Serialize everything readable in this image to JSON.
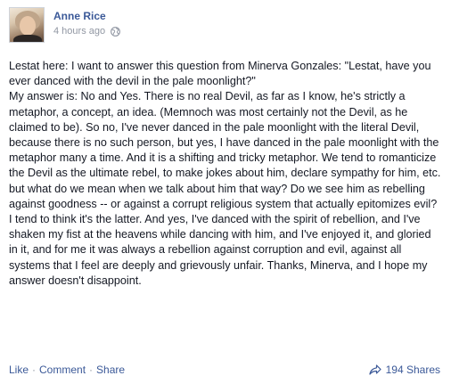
{
  "post": {
    "author": "Anne Rice",
    "timestamp": "4 hours ago",
    "privacy_icon": "globe-icon",
    "paragraphs": [
      "Lestat here: I want to answer this question from Minerva Gonzales: \"Lestat, have you ever danced with the devil in the pale moonlight?\"",
      "My answer is: No and Yes. There is no real Devil, as far as I know, he's strictly a metaphor, a concept, an idea. (Memnoch was most certainly not the Devil, as he claimed to be). So no, I've never danced in the pale moonlight with the literal Devil, because there is no such person, but yes, I have danced in the pale moonlight with the metaphor many a time. And it is a shifting and tricky metaphor. We tend to romanticize the Devil as the ultimate rebel, to make jokes about him, declare sympathy for him, etc. but what do we mean when we talk about him that way? Do we see him as rebelling against goodness -- or against a corrupt religious system that actually epitomizes evil? I tend to think it's the latter. And yes, I've danced with the spirit of rebellion, and I've shaken my fist at the heavens while dancing with him, and I've enjoyed it, and gloried in it, and for me it was always a rebellion against corruption and evil, against all systems that I feel are deeply and grievously unfair. Thanks, Minerva, and I hope my answer doesn't disappoint."
    ]
  },
  "actions": {
    "like": "Like",
    "comment": "Comment",
    "share": "Share",
    "separator": "·"
  },
  "shares": {
    "label": "194 Shares",
    "icon": "share-arrow-icon"
  },
  "colors": {
    "link": "#3b5998",
    "meta": "#9197a3",
    "text": "#141823"
  }
}
